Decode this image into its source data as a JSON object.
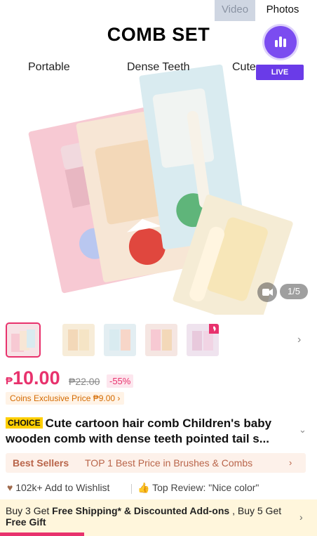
{
  "media_tabs": {
    "video": "Video",
    "photos": "Photos"
  },
  "hero": {
    "title": "COMB SET",
    "features": [
      "Portable",
      "Dense Teeth",
      "Cute"
    ],
    "live_label": "LIVE",
    "counter": "1/5"
  },
  "thumbnails": {
    "count": 5,
    "selected_index": 0
  },
  "price": {
    "currency": "₱",
    "amount": "10.00",
    "original": "₱22.00",
    "discount": "-55%",
    "coins_exclusive": "Coins Exclusive Price ₱9.00"
  },
  "product": {
    "choice_badge": "CHOICE",
    "title": "Cute cartoon hair comb Children's baby wooden comb with dense teeth pointed tail s..."
  },
  "best_sellers": {
    "brand": "Best Sellers",
    "text": "TOP 1 Best Price in Brushes & Combs"
  },
  "social": {
    "wishlist": "102k+ Add to Wishlist",
    "review": "Top Review: \"Nice color\""
  },
  "promo": {
    "part1": "Buy 3 Get ",
    "bold1": "Free Shipping* & Discounted Add-ons",
    "part2": " , Buy 5 Get ",
    "bold2": "Free Gift"
  },
  "colors": {
    "accent": "#e8326d",
    "live": "#6a3be8",
    "choice_badge": "#ffcf00",
    "best_sellers": "#b9654a",
    "coins": "#d46a00"
  }
}
